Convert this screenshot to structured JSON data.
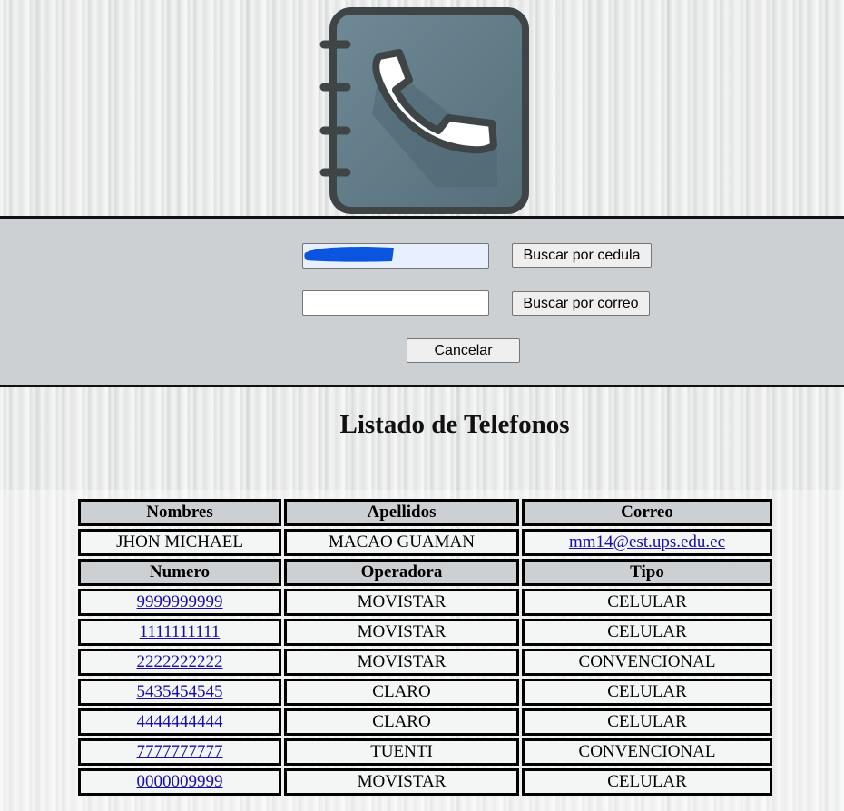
{
  "logo": {
    "icon": "phonebook-icon"
  },
  "search": {
    "cedula_value": "",
    "correo_value": "",
    "buscar_cedula_label": "Buscar por cedula",
    "buscar_correo_label": "Buscar por correo",
    "cancelar_label": "Cancelar"
  },
  "page_title": "Listado de Telefonos",
  "contact": {
    "headers": [
      "Nombres",
      "Apellidos",
      "Correo"
    ],
    "nombres": "JHON MICHAEL",
    "apellidos": "MACAO GUAMAN",
    "correo": "mm14@est.ups.edu.ec"
  },
  "phones": {
    "headers": [
      "Numero",
      "Operadora",
      "Tipo"
    ],
    "rows": [
      {
        "numero": "9999999999",
        "operadora": "MOVISTAR",
        "tipo": "CELULAR"
      },
      {
        "numero": "1111111111",
        "operadora": "MOVISTAR",
        "tipo": "CELULAR"
      },
      {
        "numero": "2222222222",
        "operadora": "MOVISTAR",
        "tipo": "CONVENCIONAL"
      },
      {
        "numero": "5435454545",
        "operadora": "CLARO",
        "tipo": "CELULAR"
      },
      {
        "numero": "4444444444",
        "operadora": "CLARO",
        "tipo": "CELULAR"
      },
      {
        "numero": "7777777777",
        "operadora": "TUENTI",
        "tipo": "CONVENCIONAL"
      },
      {
        "numero": "0000009999",
        "operadora": "MOVISTAR",
        "tipo": "CELULAR"
      }
    ]
  },
  "colors": {
    "band": "#ccd0d3",
    "book_cover": "#607d8b",
    "book_border": "#3f4447",
    "link": "#1a0dab",
    "redaction": "#0a55e0"
  }
}
